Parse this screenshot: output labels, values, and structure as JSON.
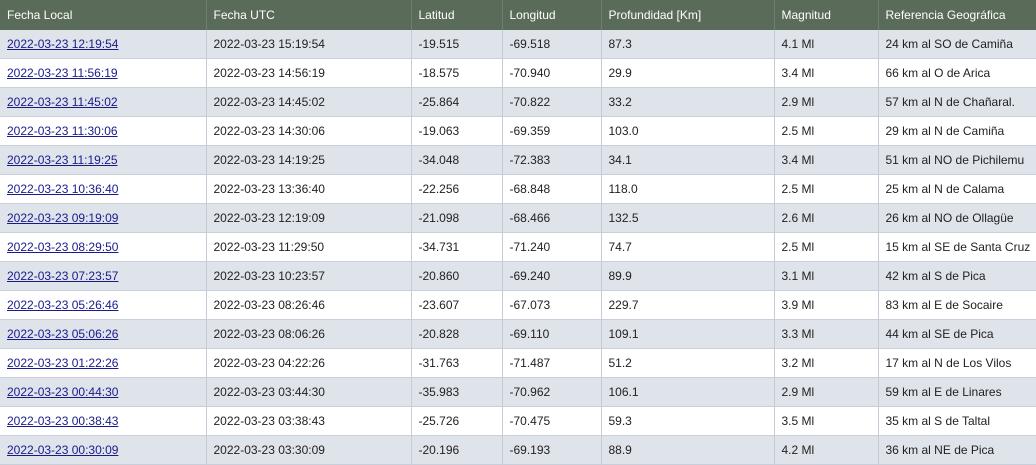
{
  "headers": [
    "Fecha Local",
    "Fecha UTC",
    "Latitud",
    "Longitud",
    "Profundidad [Km]",
    "Magnitud",
    "Referencia Geográfica"
  ],
  "rows": [
    [
      "2022-03-23 12:19:54",
      "2022-03-23 15:19:54",
      "-19.515",
      "-69.518",
      "87.3",
      "4.1 Ml",
      "24 km al SO de Camiña"
    ],
    [
      "2022-03-23 11:56:19",
      "2022-03-23 14:56:19",
      "-18.575",
      "-70.940",
      "29.9",
      "3.4 Ml",
      "66 km al O de Arica"
    ],
    [
      "2022-03-23 11:45:02",
      "2022-03-23 14:45:02",
      "-25.864",
      "-70.822",
      "33.2",
      "2.9 Ml",
      "57 km al N de Chañaral."
    ],
    [
      "2022-03-23 11:30:06",
      "2022-03-23 14:30:06",
      "-19.063",
      "-69.359",
      "103.0",
      "2.5 Ml",
      "29 km al N de Camiña"
    ],
    [
      "2022-03-23 11:19:25",
      "2022-03-23 14:19:25",
      "-34.048",
      "-72.383",
      "34.1",
      "3.4 Ml",
      "51 km al NO de Pichilemu"
    ],
    [
      "2022-03-23 10:36:40",
      "2022-03-23 13:36:40",
      "-22.256",
      "-68.848",
      "118.0",
      "2.5 Ml",
      "25 km al N de Calama"
    ],
    [
      "2022-03-23 09:19:09",
      "2022-03-23 12:19:09",
      "-21.098",
      "-68.466",
      "132.5",
      "2.6 Ml",
      "26 km al NO de Ollagüe"
    ],
    [
      "2022-03-23 08:29:50",
      "2022-03-23 11:29:50",
      "-34.731",
      "-71.240",
      "74.7",
      "2.5 Ml",
      "15 km al SE de Santa Cruz"
    ],
    [
      "2022-03-23 07:23:57",
      "2022-03-23 10:23:57",
      "-20.860",
      "-69.240",
      "89.9",
      "3.1 Ml",
      "42 km al S de Pica"
    ],
    [
      "2022-03-23 05:26:46",
      "2022-03-23 08:26:46",
      "-23.607",
      "-67.073",
      "229.7",
      "3.9 Ml",
      "83 km al E de Socaire"
    ],
    [
      "2022-03-23 05:06:26",
      "2022-03-23 08:06:26",
      "-20.828",
      "-69.110",
      "109.1",
      "3.3 Ml",
      "44 km al SE de Pica"
    ],
    [
      "2022-03-23 01:22:26",
      "2022-03-23 04:22:26",
      "-31.763",
      "-71.487",
      "51.2",
      "3.2 Ml",
      "17 km al N de Los Vilos"
    ],
    [
      "2022-03-23 00:44:30",
      "2022-03-23 03:44:30",
      "-35.983",
      "-70.962",
      "106.1",
      "2.9 Ml",
      "59 km al E de Linares"
    ],
    [
      "2022-03-23 00:38:43",
      "2022-03-23 03:38:43",
      "-25.726",
      "-70.475",
      "59.3",
      "3.5 Ml",
      "35 km al S de Taltal"
    ],
    [
      "2022-03-23 00:30:09",
      "2022-03-23 03:30:09",
      "-20.196",
      "-69.193",
      "88.9",
      "4.2 Ml",
      "36 km al NE de Pica"
    ]
  ]
}
